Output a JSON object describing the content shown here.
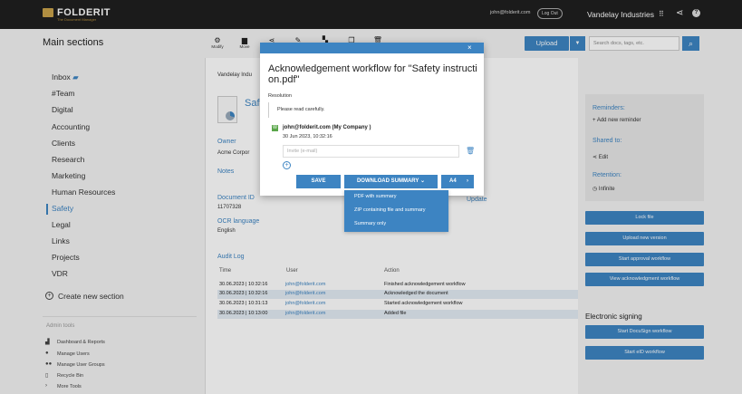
{
  "topbar": {
    "logo": "FOLDERIT",
    "logo_tag": "The Document Manager",
    "user_email": "john@folderit.com",
    "logout": "Log Out",
    "company": "Vandelay Industries"
  },
  "header": {
    "title": "Main sections",
    "tools": [
      {
        "label": "Modify",
        "icon": "gear-icon"
      },
      {
        "label": "Move",
        "icon": "folder-icon"
      },
      {
        "label": "",
        "icon": "share-icon"
      },
      {
        "label": "",
        "icon": "pen-icon"
      },
      {
        "label": "",
        "icon": "binoculars-icon"
      },
      {
        "label": "",
        "icon": "copy-icon"
      },
      {
        "label": "",
        "icon": "trash-icon"
      }
    ],
    "upload": "Upload",
    "search_placeholder": "Search docs, tags, etc."
  },
  "sidebar": {
    "items": [
      "Inbox",
      "#Team",
      "Digital",
      "Accounting",
      "Clients",
      "Research",
      "Marketing",
      "Human Resources",
      "Safety",
      "Legal",
      "Links",
      "Projects",
      "VDR"
    ],
    "active": "Safety",
    "create": "Create new section",
    "admin_title": "Admin tools",
    "admin_items": [
      "Dashboard & Reports",
      "Manage Users",
      "Manage User Groups",
      "Recycle Bin",
      "More Tools"
    ]
  },
  "document": {
    "breadcrumb": "Vandelay Indu",
    "title_fragment": "Safe",
    "owner_label": "Owner",
    "owner_value": "Acme Corpor",
    "notes_label": "Notes",
    "docid_label": "Document ID",
    "docid_value": "11707328",
    "ocr_label": "OCR language",
    "ocr_value": "English",
    "update_label": "Update"
  },
  "audit": {
    "title": "Audit Log",
    "columns": [
      "Time",
      "User",
      "Action"
    ],
    "rows": [
      {
        "time": "30.06.2023 | 10:32:16",
        "user": "john@folderit.com",
        "action": "Finished acknowledgement workflow"
      },
      {
        "time": "30.06.2023 | 10:32:16",
        "user": "john@folderit.com",
        "action": "Acknowledged the document"
      },
      {
        "time": "30.06.2023 | 10:31:13",
        "user": "john@folderit.com",
        "action": "Started acknowledgement workflow"
      },
      {
        "time": "30.06.2023 | 10:13:00",
        "user": "john@folderit.com",
        "action": "Added file"
      }
    ]
  },
  "right_panel": {
    "reminders_label": "Reminders:",
    "add_reminder": "Add new reminder",
    "shared_label": "Shared to:",
    "edit": "Edit",
    "retention_label": "Retention:",
    "retention_value": "Infinite",
    "buttons": [
      "Lock file",
      "Upload new version",
      "Start approval workflow",
      "View acknowledgment workflow"
    ],
    "esign_title": "Electronic signing",
    "esign_buttons": [
      "Start DocuSign workflow",
      "Start eID workflow"
    ]
  },
  "modal": {
    "title": "Acknowledgement workflow for \"Safety instructi on.pdf\"",
    "resolution_label": "Resolution",
    "resolution_text": "Please read carefully.",
    "user": "john@folderit.com (My Company )",
    "user_badge": "W",
    "date": "30 Jun 2023, 10:32:16",
    "invite_placeholder": "Invite (e-mail)",
    "save": "SAVE",
    "download": "DOWNLOAD SUMMARY",
    "paper": "A4",
    "dropdown": [
      "PDF with summary",
      "ZIP containing file and summary",
      "Summary only"
    ]
  },
  "colors": {
    "accent": "#3d84c2",
    "topbar": "#1f1f1f",
    "logo": "#c9a24a"
  }
}
